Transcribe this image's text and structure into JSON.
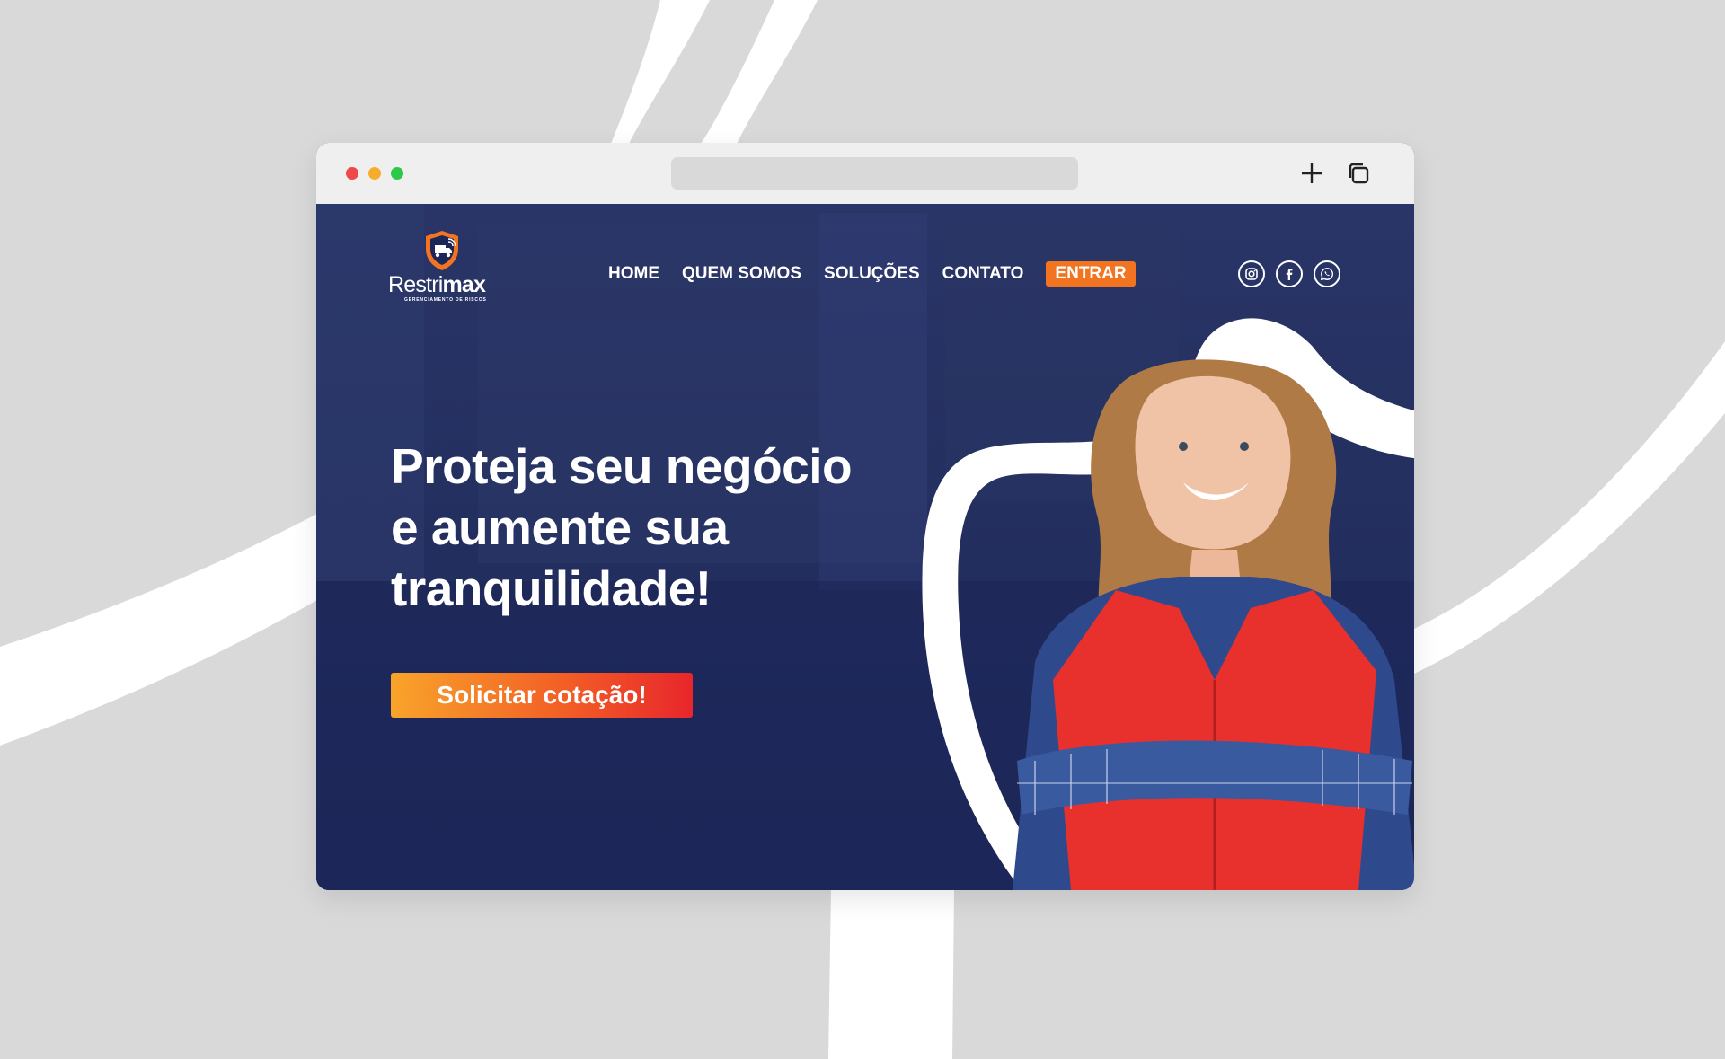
{
  "browser": {
    "controls": [
      "close",
      "minimize",
      "maximize"
    ],
    "new_tab_icon": "plus-icon",
    "tabs_icon": "copy-icon"
  },
  "site": {
    "logo": {
      "name_light": "Restri",
      "name_bold": "max",
      "tagline": "GERENCIAMENTO DE RISCOS"
    },
    "nav": {
      "home": "HOME",
      "quem_somos": "QUEM SOMOS",
      "solucoes": "SOLUÇÕES",
      "contato": "CONTATO",
      "entrar": "ENTRAR"
    },
    "social": [
      "instagram-icon",
      "facebook-icon",
      "whatsapp-icon"
    ],
    "hero": {
      "headline_line1": "Proteja seu negócio",
      "headline_line2": "e aumente sua",
      "headline_line3": "tranquilidade!",
      "cta_label": "Solicitar cotação!"
    }
  },
  "colors": {
    "hero_bg": "#1c2657",
    "accent_orange": "#f27320",
    "cta_gradient_start": "#f8a42a",
    "cta_gradient_end": "#e8262b",
    "page_bg": "#d9d9d9"
  }
}
